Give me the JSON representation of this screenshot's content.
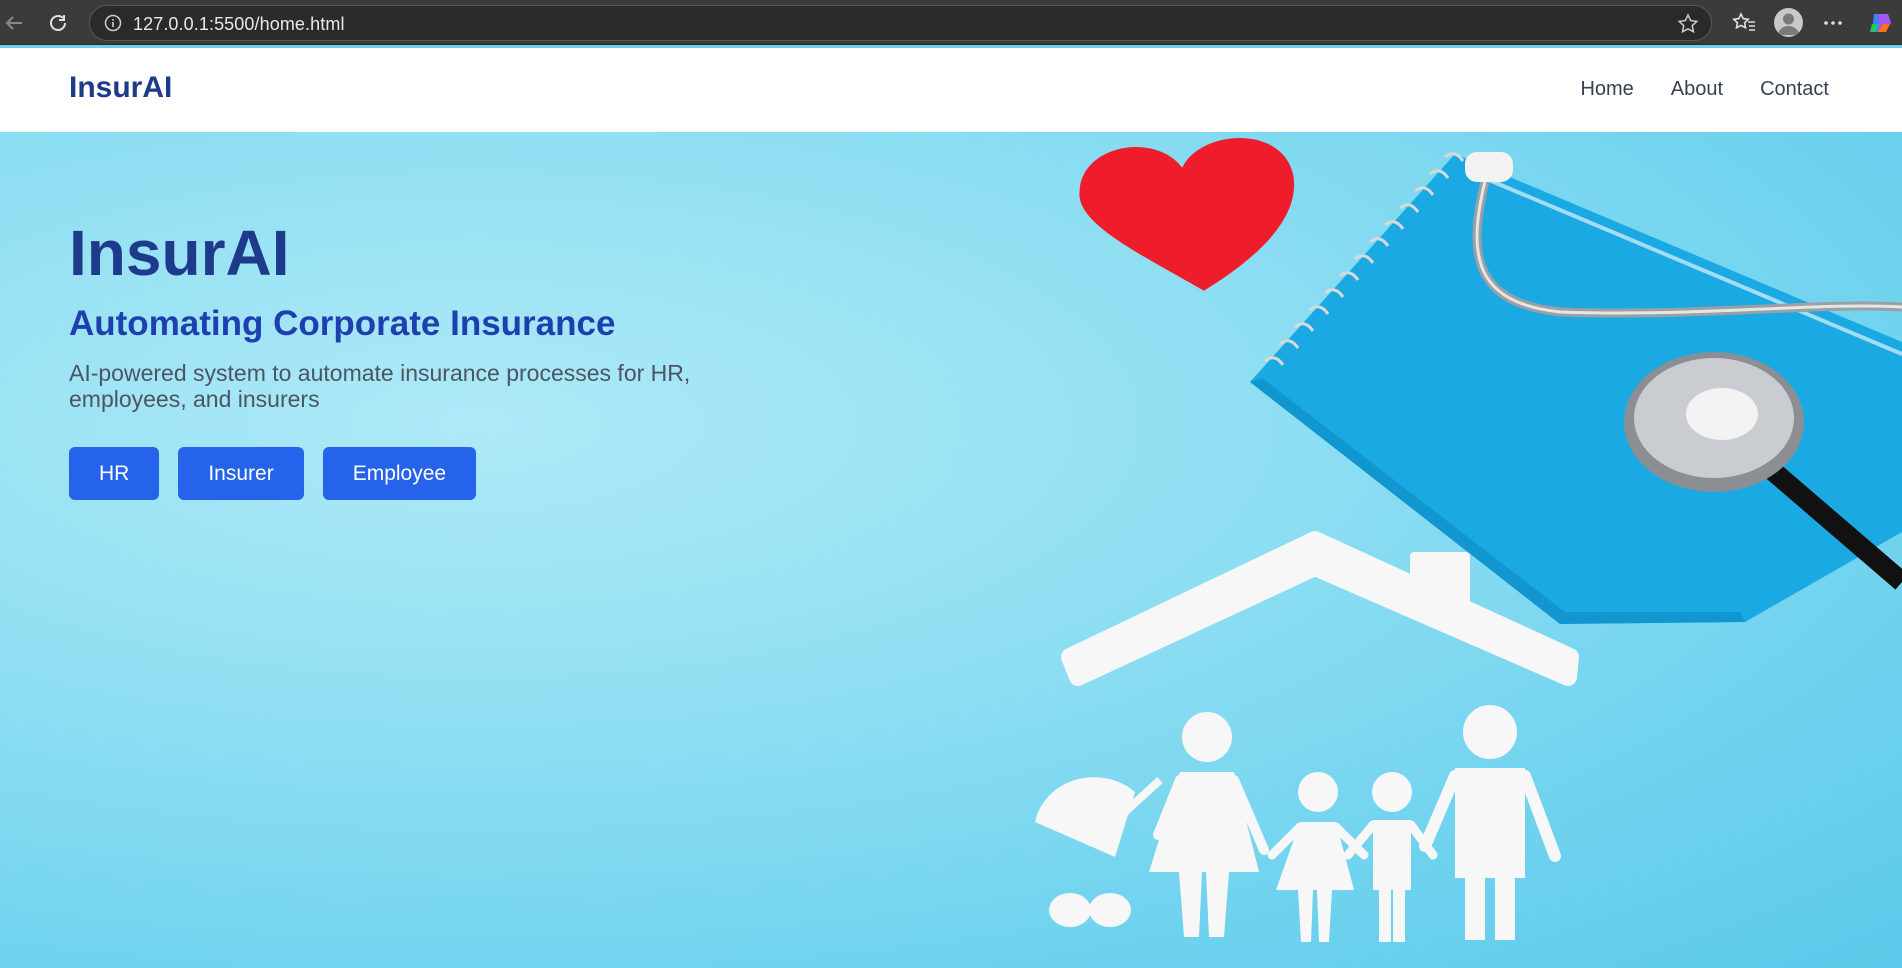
{
  "browser": {
    "url": "127.0.0.1:5500/home.html"
  },
  "nav": {
    "brand": "InsurAI",
    "links": [
      "Home",
      "About",
      "Contact"
    ]
  },
  "hero": {
    "title": "InsurAI",
    "subtitle": "Automating Corporate Insurance",
    "description": "AI-powered system to automate insurance processes for HR, employees, and insurers",
    "buttons": [
      "HR",
      "Insurer",
      "Employee"
    ]
  },
  "colors": {
    "brand": "#1e3a8a",
    "accent": "#2563eb",
    "hero_bg": "#93e0f3"
  },
  "icons": [
    "back-icon",
    "reload-icon",
    "info-icon",
    "star-icon",
    "favorites-icon",
    "profile-icon",
    "more-icon",
    "copilot-icon"
  ]
}
